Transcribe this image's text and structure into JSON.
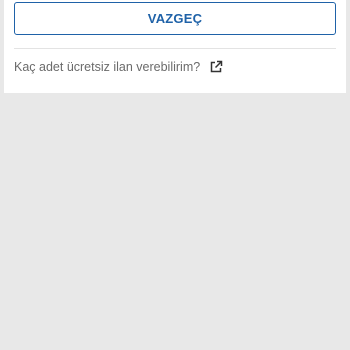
{
  "actions": {
    "cancel_label": "VAZGEÇ"
  },
  "help": {
    "link_text": "Kaç adet ücretsiz ilan verebilirim?",
    "icon": "external-link-icon"
  },
  "colors": {
    "accent": "#1f62a8",
    "background": "#e8e8e8",
    "card": "#ffffff",
    "muted_text": "#6b6b6b"
  }
}
